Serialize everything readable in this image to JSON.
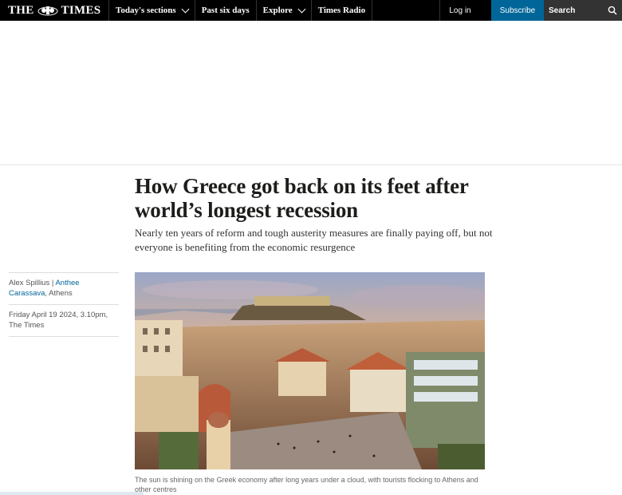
{
  "header": {
    "logo_left": "THE",
    "logo_right": "TIMES",
    "nav": [
      {
        "label": "Today's sections",
        "dropdown": true
      },
      {
        "label": "Past six days",
        "dropdown": false
      },
      {
        "label": "Explore",
        "dropdown": true
      },
      {
        "label": "Times Radio",
        "dropdown": false
      }
    ],
    "login": "Log in",
    "subscribe": "Subscribe",
    "search": "Search"
  },
  "article": {
    "headline": "How Greece got back on its feet after world’s longest recession",
    "standfirst": "Nearly ten years of reform and tough austerity measures are finally paying off, but not everyone is benefiting from the economic resurgence",
    "byline": {
      "author1": "Alex Spillius | ",
      "author2": "Anthee Carassava",
      "location": ", Athens",
      "date": "Friday April 19 2024, 3.10pm,",
      "publication": "The Times"
    },
    "image_caption": "The sun is shining on the Greek economy after long years under a cloud, with tourists flocking to Athens and other centres"
  },
  "colors": {
    "nav_bg": "#000000",
    "subscribe_bg": "#006699",
    "search_bg": "#333333",
    "link": "#006699"
  }
}
